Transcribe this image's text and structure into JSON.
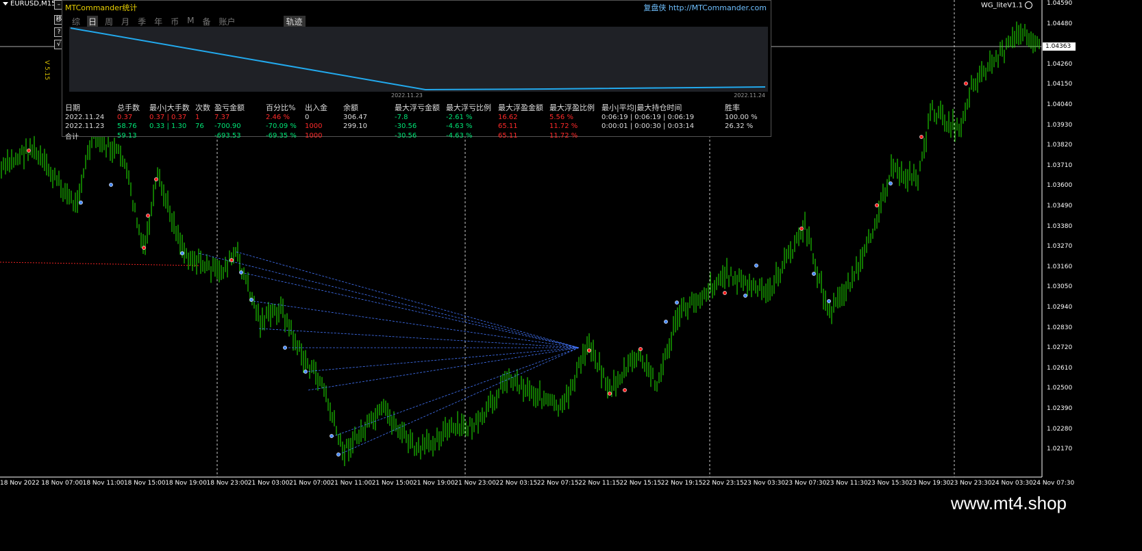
{
  "window": {
    "symbol": "EURUSD,M15",
    "indicator_name": "WG_liteV1.1",
    "version": "V 5.15"
  },
  "toolbar": {
    "buttons": [
      "移",
      "?",
      "√"
    ]
  },
  "panel": {
    "title": "MTCommander统计",
    "link": "复盘侠 http://MTCommander.com",
    "tabs": [
      "综",
      "日",
      "周",
      "月",
      "季",
      "年",
      "币",
      "M",
      "备",
      "账户"
    ],
    "active_tab": "日",
    "track_tab": "轨迹",
    "mini_chart": {
      "start_label": "2022.11.23",
      "end_label": "2022.11.24"
    },
    "columns": [
      "日期",
      "总手数",
      "最小|大手数",
      "次数",
      "盈亏金额",
      "百分比%",
      "出入金",
      "余额",
      "最大浮亏金额",
      "最大浮亏比例",
      "最大浮盈金额",
      "最大浮盈比例",
      "最小|平均|最大持仓时间",
      "胜率"
    ],
    "rows": [
      [
        "2022.11.24",
        "0.37",
        "0.37 | 0.37",
        "1",
        "7.37",
        "2.46 %",
        "0",
        "306.47",
        "-7.8",
        "-2.61 %",
        "16.62",
        "5.56 %",
        "0:06:19 | 0:06:19 | 0:06:19",
        "100.00 %"
      ],
      [
        "2022.11.23",
        "58.76",
        "0.33 | 1.30",
        "76",
        "-700.90",
        "-70.09 %",
        "1000",
        "299.10",
        "-30.56",
        "-4.63 %",
        "65.11",
        "11.72 %",
        "0:00:01 | 0:00:30 | 0:03:14",
        "26.32 %"
      ],
      [
        "合计",
        "59.13",
        "",
        "",
        "-693.53",
        "-69.35 %",
        "1000",
        "",
        "-30.56",
        "-4.63 %",
        "65.11",
        "11.72 %",
        "",
        ""
      ]
    ],
    "row_colors": [
      [
        "w",
        "r",
        "r",
        "r",
        "r",
        "r",
        "w",
        "w",
        "g",
        "g",
        "r",
        "r",
        "w",
        "w"
      ],
      [
        "w",
        "g",
        "g",
        "g",
        "g",
        "g",
        "r",
        "w",
        "g",
        "g",
        "r",
        "r",
        "w",
        "w"
      ],
      [
        "w",
        "g",
        "w",
        "w",
        "g",
        "g",
        "r",
        "w",
        "g",
        "g",
        "r",
        "r",
        "w",
        "w"
      ]
    ]
  },
  "price_axis": [
    "1.04590",
    "1.04480",
    "1.04363",
    "1.04260",
    "1.04150",
    "1.04040",
    "1.03930",
    "1.03820",
    "1.03710",
    "1.03600",
    "1.03490",
    "1.03380",
    "1.03270",
    "1.03160",
    "1.03050",
    "1.02940",
    "1.02830",
    "1.02720",
    "1.02610",
    "1.02500",
    "1.02390",
    "1.02280",
    "1.02170"
  ],
  "current_price": "1.04363",
  "time_axis": [
    "18 Nov 2022",
    "18 Nov 07:00",
    "18 Nov 11:00",
    "18 Nov 15:00",
    "18 Nov 19:00",
    "18 Nov 23:00",
    "21 Nov 03:00",
    "21 Nov 07:00",
    "21 Nov 11:00",
    "21 Nov 15:00",
    "21 Nov 19:00",
    "21 Nov 23:00",
    "22 Nov 03:15",
    "22 Nov 07:15",
    "22 Nov 11:15",
    "22 Nov 15:15",
    "22 Nov 19:15",
    "22 Nov 23:15",
    "23 Nov 03:30",
    "23 Nov 07:30",
    "23 Nov 11:30",
    "23 Nov 15:30",
    "23 Nov 19:30",
    "23 Nov 23:30",
    "24 Nov 03:30",
    "24 Nov 07:30"
  ],
  "watermark": "www.mt4.shop",
  "colors": {
    "bull": "#22ee00",
    "panel_line": "#22aaee",
    "trade_line": "#4477ff",
    "loss_line": "#ee2222"
  }
}
